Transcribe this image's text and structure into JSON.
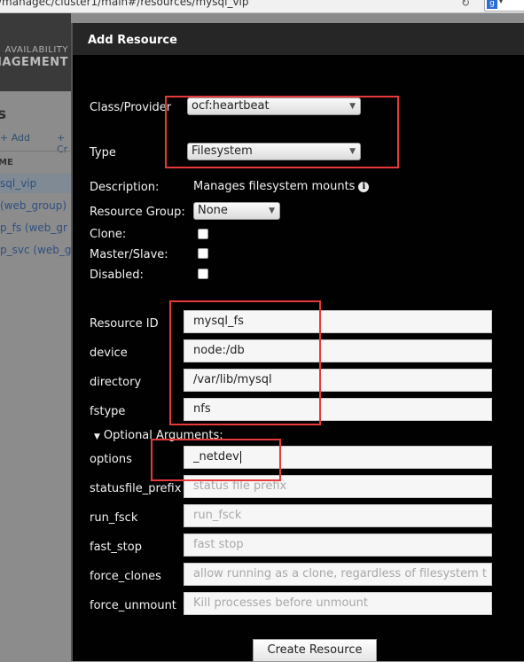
{
  "browser": {
    "url": "/managec/cluster1/main#/resources/mysql_vip",
    "reload_glyph": "↻",
    "search_engine_glyph": "g",
    "dropdown_glyph": "▾"
  },
  "app": {
    "brand_line1": "AVAILABILITY",
    "brand_line2": "NAGEMENT",
    "section_title": "s",
    "add_label": "+ Add",
    "add_label2": "+ Cr",
    "column_header": "ME",
    "resources": [
      "sql_vip",
      "(web_group)",
      "p_fs (web_gr",
      "p_svc (web_g"
    ]
  },
  "dialog": {
    "title": "Add Resource",
    "class_provider_label": "Class/Provider",
    "class_provider_value": "ocf:heartbeat",
    "type_label": "Type",
    "type_value": "Filesystem",
    "description_label": "Description:",
    "description_value": "Manages filesystem mounts",
    "info_icon_glyph": "i",
    "resource_group_label": "Resource Group:",
    "resource_group_value": "None",
    "clone_label": "Clone:",
    "master_slave_label": "Master/Slave:",
    "disabled_label": "Disabled:",
    "resource_id_label": "Resource ID",
    "resource_id_value": "mysql_fs",
    "device_label": "device",
    "device_value": "node:/db",
    "directory_label": "directory",
    "directory_value": "/var/lib/mysql",
    "fstype_label": "fstype",
    "fstype_value": "nfs",
    "optional_toggle_glyph": "▼",
    "optional_label": "Optional Arguments:",
    "options_label": "options",
    "options_value": "_netdev",
    "statusfile_label": "statusfile_prefix",
    "statusfile_placeholder": "status file prefix",
    "run_fsck_label": "run_fsck",
    "run_fsck_placeholder": "run_fsck",
    "fast_stop_label": "fast_stop",
    "fast_stop_placeholder": "fast stop",
    "force_clones_label": "force_clones",
    "force_clones_placeholder": "allow running as a clone, regardless of filesystem t",
    "force_unmount_label": "force_unmount",
    "force_unmount_placeholder": "Kill processes before unmount",
    "create_button": "Create Resource"
  },
  "colors": {
    "dialog_background": "#010101",
    "highlight_box": "#e63a3a"
  }
}
